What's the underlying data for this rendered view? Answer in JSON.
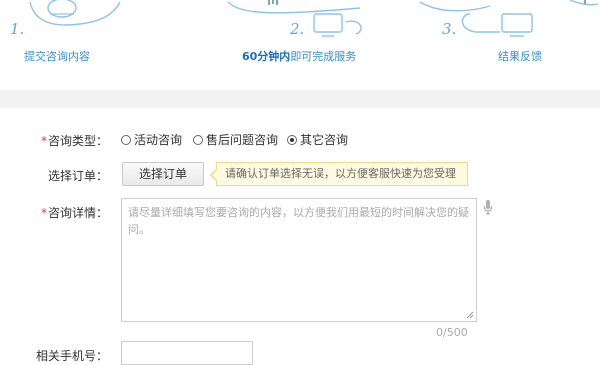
{
  "steps": [
    {
      "number": "1.",
      "caption": "提交咨询内容"
    },
    {
      "number": "2.",
      "caption_bold": "60分钟内",
      "caption": "即可完成服务"
    },
    {
      "number": "3.",
      "caption": "结果反馈"
    }
  ],
  "form": {
    "consult_type": {
      "label": "咨询类型：",
      "options": [
        {
          "label": "活动咨询",
          "selected": false
        },
        {
          "label": "售后问题咨询",
          "selected": false
        },
        {
          "label": "其它咨询",
          "selected": true
        }
      ]
    },
    "order": {
      "label": "选择订单：",
      "button_label": "选择订单",
      "tip": "请确认订单选择无误，以方便客服快速为您受理"
    },
    "details": {
      "label": "咨询详情：",
      "placeholder": "请尽量详细填写您要咨询的内容，以方便我们用最短的时间解决您的疑问。",
      "counter": "0/500"
    },
    "next_label": "相关手机号："
  },
  "colors": {
    "accent_blue": "#3a8fc8",
    "required_red": "#e4393c",
    "tip_bg": "#fffbe0"
  }
}
